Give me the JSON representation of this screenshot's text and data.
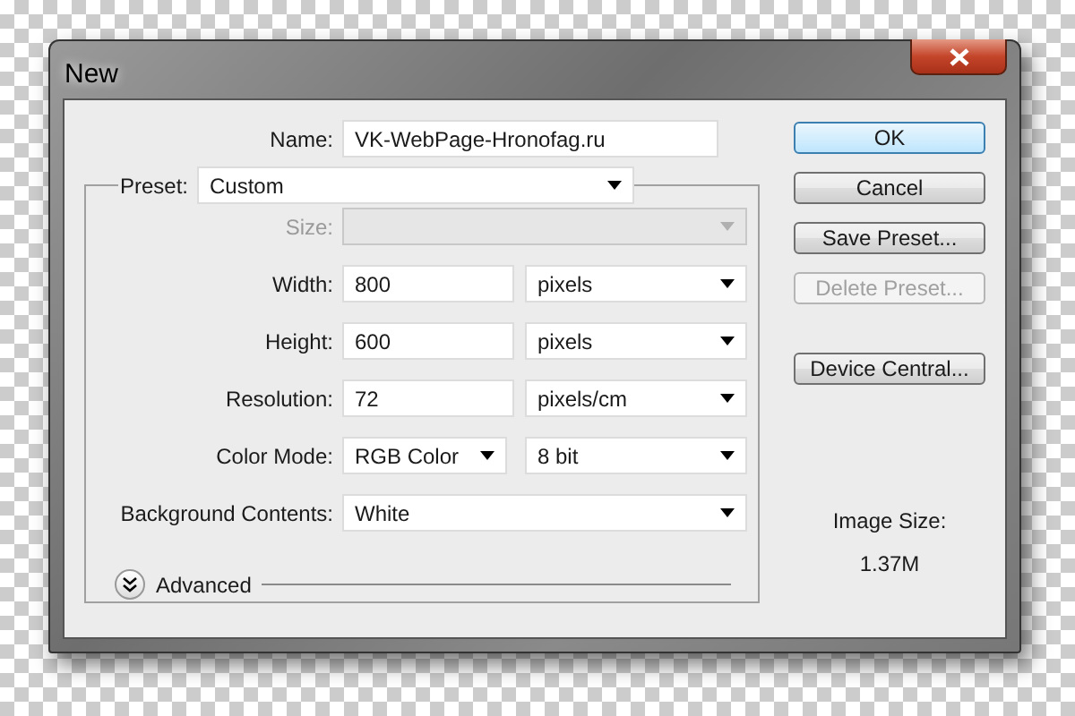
{
  "window": {
    "title": "New"
  },
  "name_field": {
    "label": "Name:",
    "value": "VK-WebPage-Hronofag.ru"
  },
  "preset": {
    "label": "Preset:",
    "value": "Custom"
  },
  "rows": [
    {
      "label": "Size:",
      "kind": "select",
      "disabled": true
    },
    {
      "label": "Width:",
      "kind": "input",
      "value": "800",
      "unit": "pixels",
      "disabled": false
    },
    {
      "label": "Height:",
      "kind": "input",
      "value": "600",
      "unit": "pixels",
      "disabled": false
    },
    {
      "label": "Resolution:",
      "kind": "input",
      "value": "72",
      "unit": "pixels/cm",
      "disabled": false
    },
    {
      "label": "Color Mode:",
      "kind": "select_pair",
      "value": "RGB Color",
      "unit": "8 bit",
      "disabled": false
    },
    {
      "label": "Background Contents:",
      "kind": "select",
      "value": "White",
      "disabled": false
    }
  ],
  "advanced": {
    "label": "Advanced",
    "expanded": false
  },
  "buttons": [
    {
      "label": "OK",
      "default": true,
      "disabled": false
    },
    {
      "label": "Cancel",
      "default": false,
      "disabled": false
    },
    {
      "label": "Save Preset...",
      "default": false,
      "disabled": false
    },
    {
      "label": "Delete Preset...",
      "default": false,
      "disabled": true
    },
    {
      "label": "Device Central...",
      "default": false,
      "disabled": false
    }
  ],
  "image_size": {
    "label": "Image Size:",
    "value": "1.37M"
  }
}
